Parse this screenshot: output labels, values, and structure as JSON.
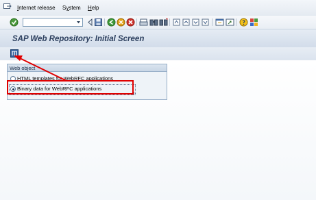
{
  "menubar": {
    "icon": "exit-menu-icon",
    "items": [
      {
        "pre": "",
        "u": "I",
        "rest": "nternet release"
      },
      {
        "pre": "S",
        "u": "y",
        "rest": "stem"
      },
      {
        "pre": "",
        "u": "H",
        "rest": "elp"
      }
    ]
  },
  "toolbar": {
    "command_field_value": "",
    "icons": [
      "enter-icon",
      "back-icon",
      "save-icon",
      "back-nav-icon",
      "exit-icon",
      "cancel-icon",
      "print-icon",
      "find-icon",
      "find-next-icon",
      "first-page-icon",
      "previous-page-icon",
      "next-page-icon",
      "last-page-icon",
      "create-session-icon",
      "shortcut-icon",
      "help-icon",
      "customize-layout-icon"
    ]
  },
  "title": {
    "text": "SAP Web Repository: Initial Screen"
  },
  "app_toolbar": {
    "icon": "object-list-icon"
  },
  "web_object": {
    "title": "Web object",
    "options": [
      {
        "label": "HTML templates for WebRFC applications",
        "selected": false
      },
      {
        "label": "Binary data for WebRFC applications",
        "selected": true
      }
    ]
  },
  "colors": {
    "highlight": "#e00000",
    "title_text": "#2c3f5e",
    "group_border": "#94acc6"
  }
}
